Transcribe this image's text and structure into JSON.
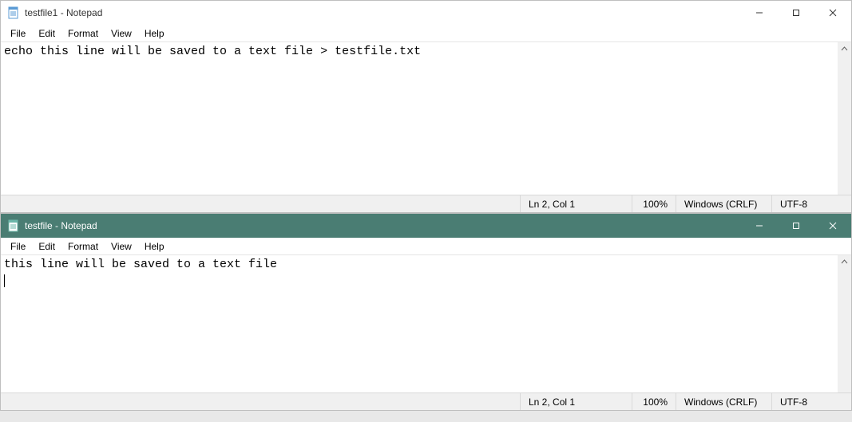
{
  "window1": {
    "title": "testfile1 - Notepad",
    "menu": {
      "file": "File",
      "edit": "Edit",
      "format": "Format",
      "view": "View",
      "help": "Help"
    },
    "content": "echo this line will be saved to a text file > testfile.txt",
    "status": {
      "pos": "Ln 2, Col 1",
      "zoom": "100%",
      "eol": "Windows (CRLF)",
      "enc": "UTF-8"
    }
  },
  "window2": {
    "title": "testfile - Notepad",
    "menu": {
      "file": "File",
      "edit": "Edit",
      "format": "Format",
      "view": "View",
      "help": "Help"
    },
    "content": "this line will be saved to a text file ",
    "status": {
      "pos": "Ln 2, Col 1",
      "zoom": "100%",
      "eol": "Windows (CRLF)",
      "enc": "UTF-8"
    }
  }
}
